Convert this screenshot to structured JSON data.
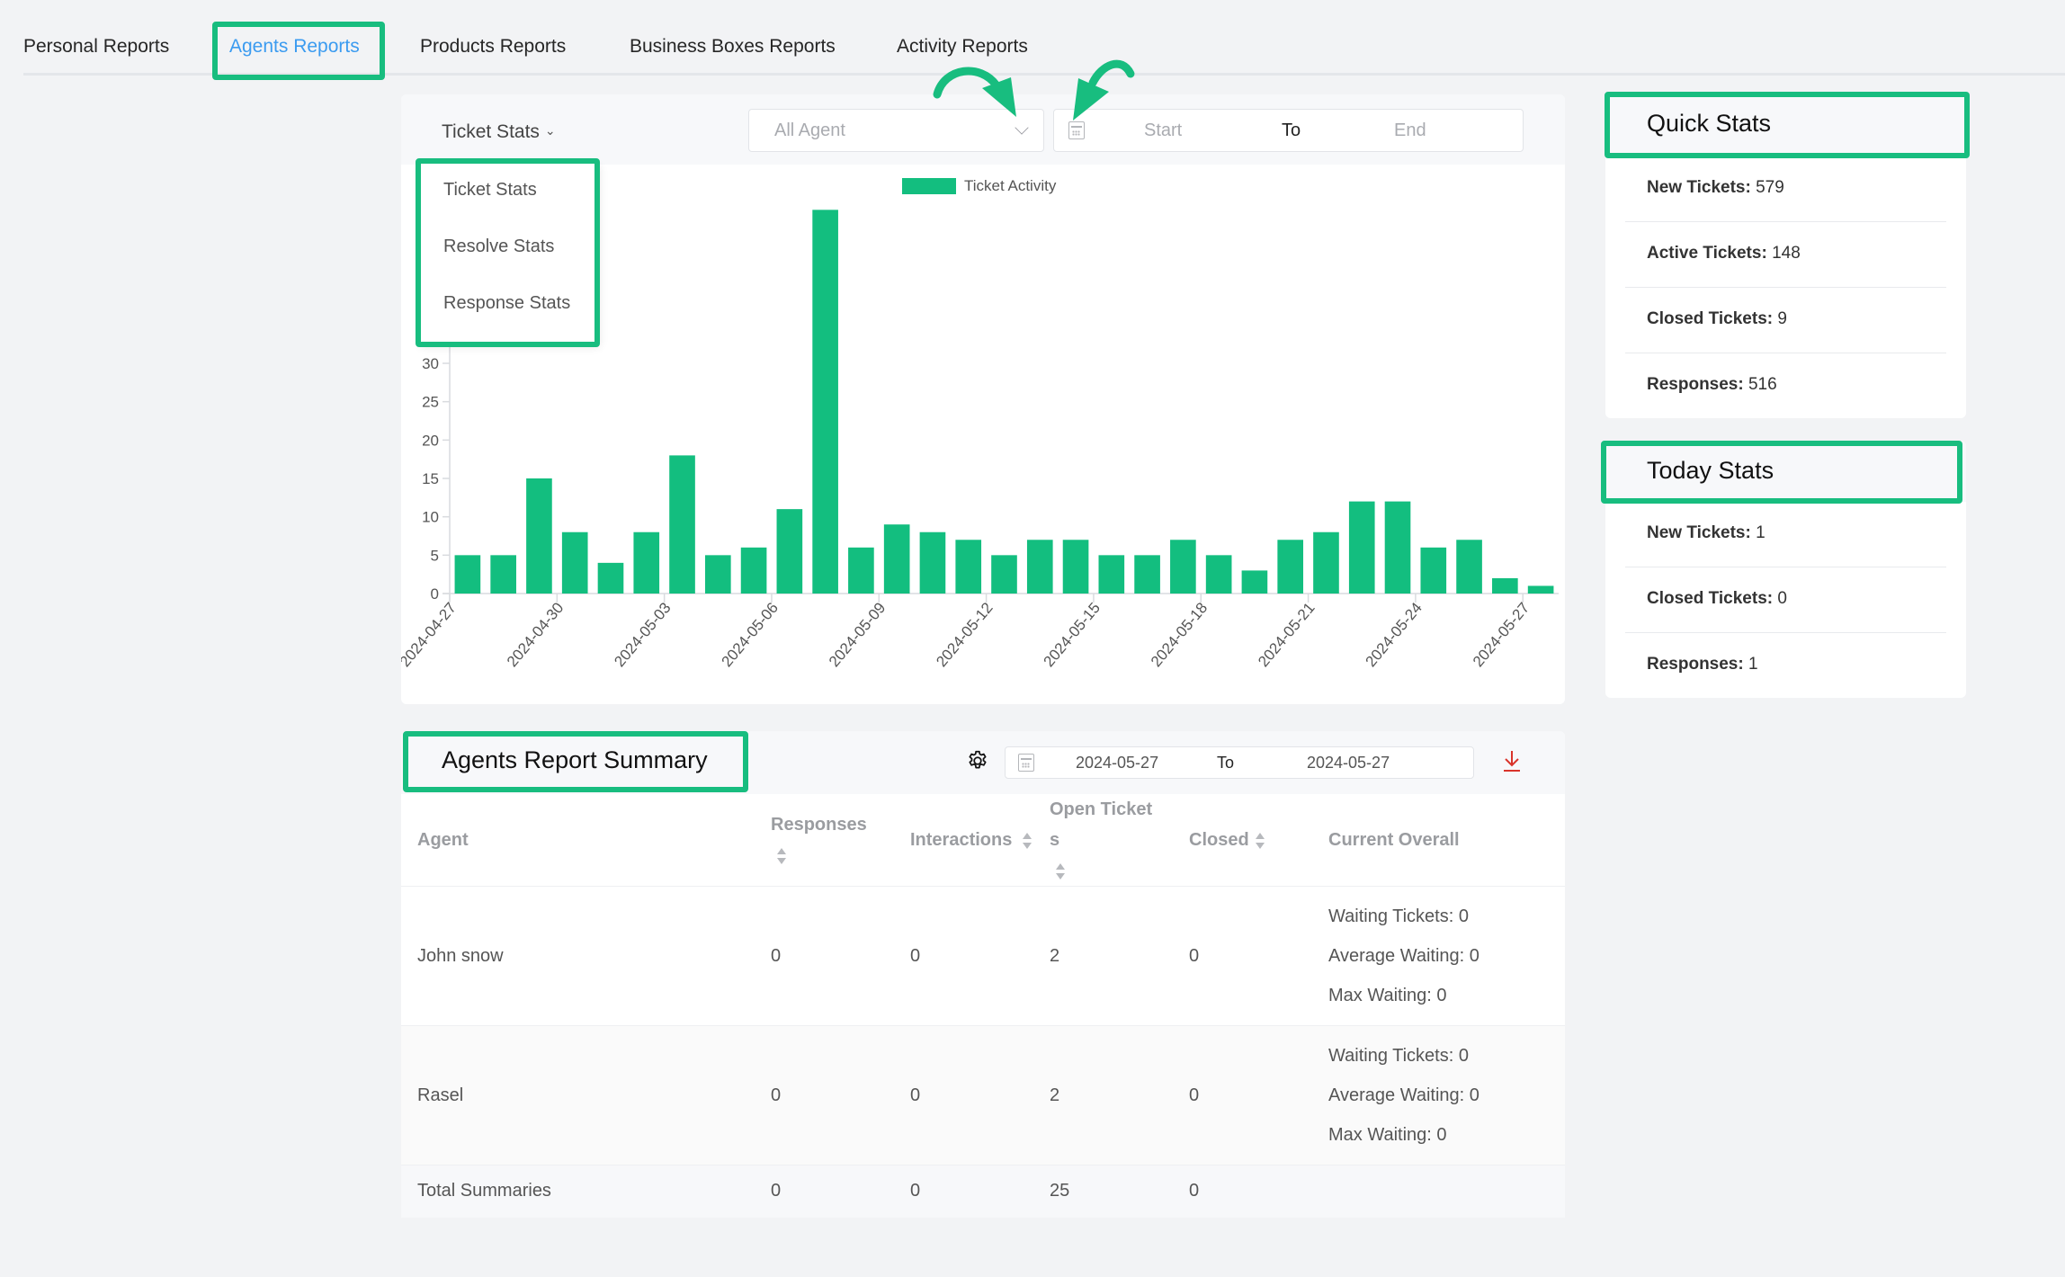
{
  "tabs": [
    {
      "label": "Personal Reports",
      "active": false
    },
    {
      "label": "Agents Reports",
      "active": true
    },
    {
      "label": "Products Reports",
      "active": false
    },
    {
      "label": "Business Boxes Reports",
      "active": false
    },
    {
      "label": "Activity Reports",
      "active": false
    }
  ],
  "filters": {
    "stats_type": {
      "selected": "Ticket Stats",
      "options": [
        "Ticket Stats",
        "Resolve Stats",
        "Response Stats"
      ],
      "open": true
    },
    "agent_select": {
      "placeholder": "All Agent"
    },
    "date_range": {
      "start_placeholder": "Start",
      "separator": "To",
      "end_placeholder": "End"
    }
  },
  "chart_data": {
    "type": "bar",
    "title": "",
    "legend": [
      "Ticket Activity"
    ],
    "legend_position": "top-center",
    "xlabel": "",
    "ylabel": "",
    "color": "#13be7f",
    "ylim": [
      0,
      50
    ],
    "yticks_visible": [
      0,
      5,
      10,
      15,
      20,
      25,
      30
    ],
    "grid": false,
    "categories": [
      "2024-04-27",
      "2024-04-28",
      "2024-04-29",
      "2024-04-30",
      "2024-05-01",
      "2024-05-02",
      "2024-05-03",
      "2024-05-04",
      "2024-05-05",
      "2024-05-06",
      "2024-05-07",
      "2024-05-08",
      "2024-05-09",
      "2024-05-10",
      "2024-05-11",
      "2024-05-12",
      "2024-05-13",
      "2024-05-14",
      "2024-05-15",
      "2024-05-16",
      "2024-05-17",
      "2024-05-18",
      "2024-05-19",
      "2024-05-20",
      "2024-05-21",
      "2024-05-22",
      "2024-05-23",
      "2024-05-24",
      "2024-05-25",
      "2024-05-26",
      "2024-05-27"
    ],
    "xtick_labels": [
      "2024-04-27",
      "2024-04-30",
      "2024-05-03",
      "2024-05-06",
      "2024-05-09",
      "2024-05-12",
      "2024-05-15",
      "2024-05-18",
      "2024-05-21",
      "2024-05-24",
      "2024-05-27"
    ],
    "series": [
      {
        "name": "Ticket Activity",
        "values": [
          5,
          5,
          15,
          8,
          4,
          8,
          18,
          5,
          6,
          11,
          50,
          6,
          9,
          8,
          7,
          5,
          7,
          7,
          5,
          5,
          7,
          5,
          3,
          7,
          8,
          12,
          12,
          6,
          7,
          2,
          1
        ]
      }
    ]
  },
  "quick_stats": {
    "title": "Quick Stats",
    "items": [
      {
        "label": "New Tickets:",
        "value": "579"
      },
      {
        "label": "Active Tickets:",
        "value": "148"
      },
      {
        "label": "Closed Tickets:",
        "value": "9"
      },
      {
        "label": "Responses:",
        "value": "516"
      }
    ]
  },
  "today_stats": {
    "title": "Today Stats",
    "items": [
      {
        "label": "New Tickets:",
        "value": "1"
      },
      {
        "label": "Closed Tickets:",
        "value": "0"
      },
      {
        "label": "Responses:",
        "value": "1"
      }
    ]
  },
  "summary": {
    "title": "Agents Report Summary",
    "date_from": "2024-05-27",
    "date_separator": "To",
    "date_to": "2024-05-27",
    "columns": [
      "Agent",
      "Responses",
      "Interactions",
      "Open Tickets",
      "Closed",
      "Current Overall"
    ],
    "rows": [
      {
        "agent": "John snow",
        "responses": "0",
        "interactions": "0",
        "open_tickets": "2",
        "closed": "0",
        "overall": [
          "Waiting Tickets: 0",
          "Average Waiting: 0",
          "Max Waiting: 0"
        ]
      },
      {
        "agent": "Rasel",
        "responses": "0",
        "interactions": "0",
        "open_tickets": "2",
        "closed": "0",
        "overall": [
          "Waiting Tickets: 0",
          "Average Waiting: 0",
          "Max Waiting: 0"
        ]
      }
    ],
    "total": {
      "label": "Total Summaries",
      "responses": "0",
      "interactions": "0",
      "open_tickets": "25",
      "closed": "0"
    }
  },
  "colors": {
    "accent": "#18bd7f",
    "active_tab": "#3b9bf0",
    "bar": "#13be7f",
    "download": "#d9342b"
  }
}
